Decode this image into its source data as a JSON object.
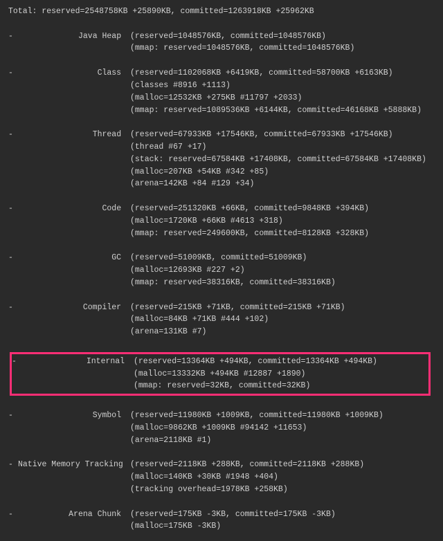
{
  "total": "Total: reserved=2548758KB +25890KB, committed=1263918KB +25962KB",
  "sections": [
    {
      "dash": true,
      "label": "Java Heap",
      "first": "(reserved=1048576KB, committed=1048576KB)",
      "cont": [
        "(mmap: reserved=1048576KB, committed=1048576KB)"
      ]
    },
    {
      "dash": true,
      "label": "Class",
      "first": "(reserved=1102068KB +6419KB, committed=58700KB +6163KB)",
      "cont": [
        "(classes #8916 +1113)",
        "(malloc=12532KB +275KB #11797 +2033)",
        "(mmap: reserved=1089536KB +6144KB, committed=46168KB +5888KB)"
      ]
    },
    {
      "dash": true,
      "label": "Thread",
      "first": "(reserved=67933KB +17546KB, committed=67933KB +17546KB)",
      "cont": [
        "(thread #67 +17)",
        "(stack: reserved=67584KB +17408KB, committed=67584KB +17408KB)",
        "(malloc=207KB +54KB #342 +85)",
        "(arena=142KB +84 #129 +34)"
      ]
    },
    {
      "dash": true,
      "label": "Code",
      "first": "(reserved=251320KB +66KB, committed=9848KB +394KB)",
      "cont": [
        "(malloc=1720KB +66KB #4613 +318)",
        "(mmap: reserved=249600KB, committed=8128KB +328KB)"
      ]
    },
    {
      "dash": true,
      "label": "GC",
      "first": "(reserved=51009KB, committed=51009KB)",
      "cont": [
        "(malloc=12693KB #227 +2)",
        "(mmap: reserved=38316KB, committed=38316KB)"
      ]
    },
    {
      "dash": true,
      "label": "Compiler",
      "first": "(reserved=215KB +71KB, committed=215KB +71KB)",
      "cont": [
        "(malloc=84KB +71KB #444 +102)",
        "(arena=131KB #7)"
      ]
    },
    {
      "dash": true,
      "highlight": true,
      "label": "Internal",
      "first": "(reserved=13364KB +494KB, committed=13364KB +494KB)",
      "cont": [
        "(malloc=13332KB +494KB #12887 +1890)",
        "(mmap: reserved=32KB, committed=32KB)"
      ]
    },
    {
      "dash": true,
      "label": "Symbol",
      "first": "(reserved=11980KB +1009KB, committed=11980KB +1009KB)",
      "cont": [
        "(malloc=9862KB +1009KB #94142 +11653)",
        "(arena=2118KB #1)"
      ]
    },
    {
      "dash": true,
      "label": "Native Memory Tracking",
      "first": "(reserved=2118KB +288KB, committed=2118KB +288KB)",
      "cont": [
        "(malloc=140KB +30KB #1948 +404)",
        "(tracking overhead=1978KB +258KB)"
      ]
    },
    {
      "dash": true,
      "label": "Arena Chunk",
      "first": "(reserved=175KB -3KB, committed=175KB -3KB)",
      "cont": [
        "(malloc=175KB -3KB)"
      ]
    }
  ]
}
